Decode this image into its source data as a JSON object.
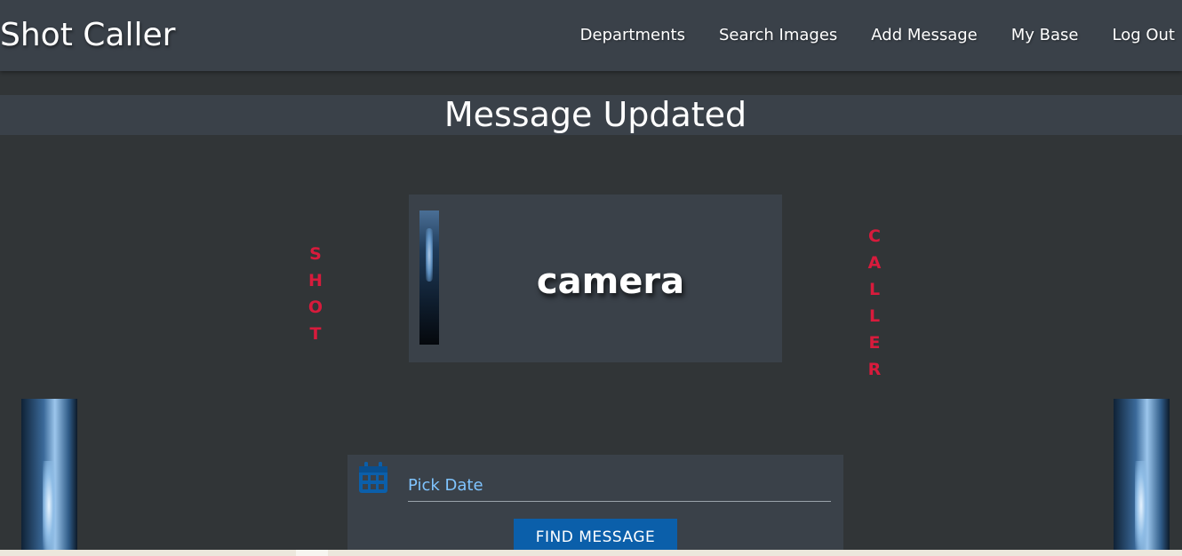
{
  "app": {
    "brand": "Shot Caller"
  },
  "nav": {
    "items": [
      {
        "label": "Departments"
      },
      {
        "label": "Search Images"
      },
      {
        "label": "Add Message"
      },
      {
        "label": "My Base"
      },
      {
        "label": "Log Out"
      }
    ]
  },
  "banner": {
    "title": "Message Updated"
  },
  "card": {
    "title": "camera",
    "thumbnail_icon": "camera-image"
  },
  "decor": {
    "left_letters": [
      "S",
      "H",
      "O",
      "T"
    ],
    "right_letters": [
      "C",
      "A",
      "L",
      "L",
      "E",
      "R"
    ],
    "accent_color": "#d81b3c"
  },
  "form": {
    "date_placeholder": "Pick Date",
    "date_value": "",
    "calendar_icon": "calendar-icon",
    "button_label": "FIND MESSAGE",
    "button_color": "#0b5faa"
  },
  "colors": {
    "page_bg": "#313537",
    "panel_bg": "#3a4149",
    "link_text": "#7fc4ff"
  }
}
